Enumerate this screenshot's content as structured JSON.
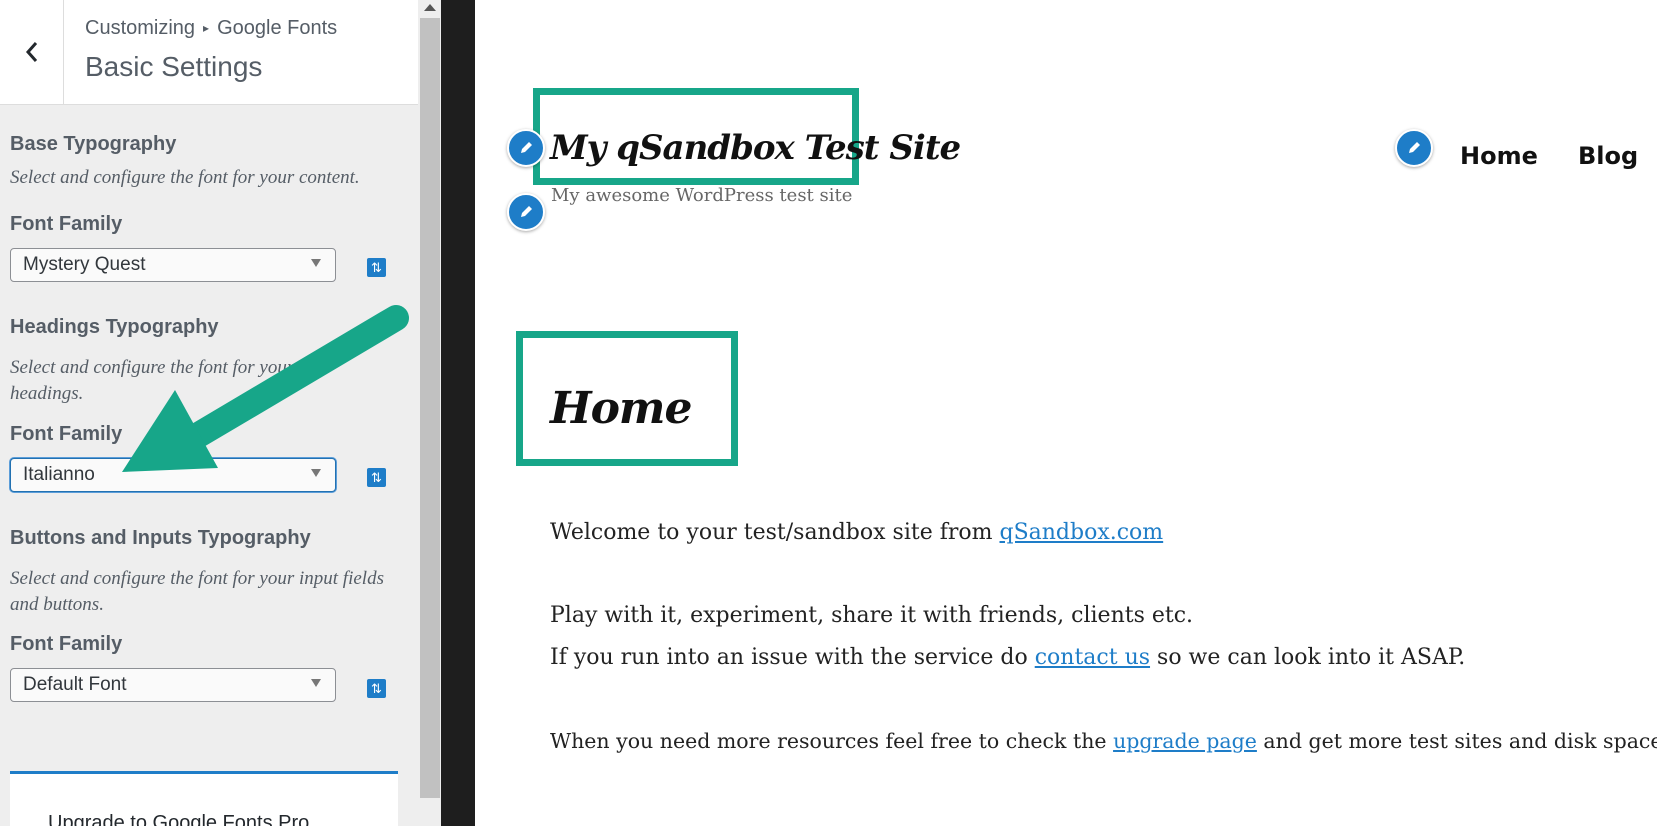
{
  "customizer": {
    "breadcrumb_root": "Customizing",
    "breadcrumb_current": "Google Fonts",
    "section_title": "Basic Settings",
    "sections": [
      {
        "heading": "Base Typography",
        "description": "Select and configure the font for your content.",
        "field_label": "Font Family",
        "value": "Mystery Quest"
      },
      {
        "heading": "Headings Typography",
        "description": "Select and configure the font for your headings.",
        "field_label": "Font Family",
        "value": "Italianno"
      },
      {
        "heading": "Buttons and Inputs Typography",
        "description": "Select and configure the font for your input fields and buttons.",
        "field_label": "Font Family",
        "value": "Default Font"
      }
    ],
    "upgrade_text": "Upgrade to Google Fonts Pro"
  },
  "preview": {
    "site_title": "My qSandbox Test Site",
    "site_tagline": "My awesome WordPress test site",
    "nav": [
      "Home",
      "Blog"
    ],
    "page_heading": "Home",
    "para1_text": "Welcome to your test/sandbox site from ",
    "para1_link": "qSandbox.com",
    "para2": "Play with it, experiment, share it with friends, clients etc.",
    "para3_text": "If you run into an issue with the service do ",
    "para3_link": "contact us",
    "para3_tail": " so we can look into it ASAP.",
    "para4_text": "When you need more resources feel free to check the ",
    "para4_link": "upgrade page",
    "para4_tail": " and get more test sites and disk space."
  },
  "colors": {
    "accent": "#1e7dc8",
    "highlight_green": "#17a689"
  },
  "icons": {
    "back": "chevron-left-icon",
    "advanced": "sliders-icon",
    "edit": "pencil-icon"
  }
}
